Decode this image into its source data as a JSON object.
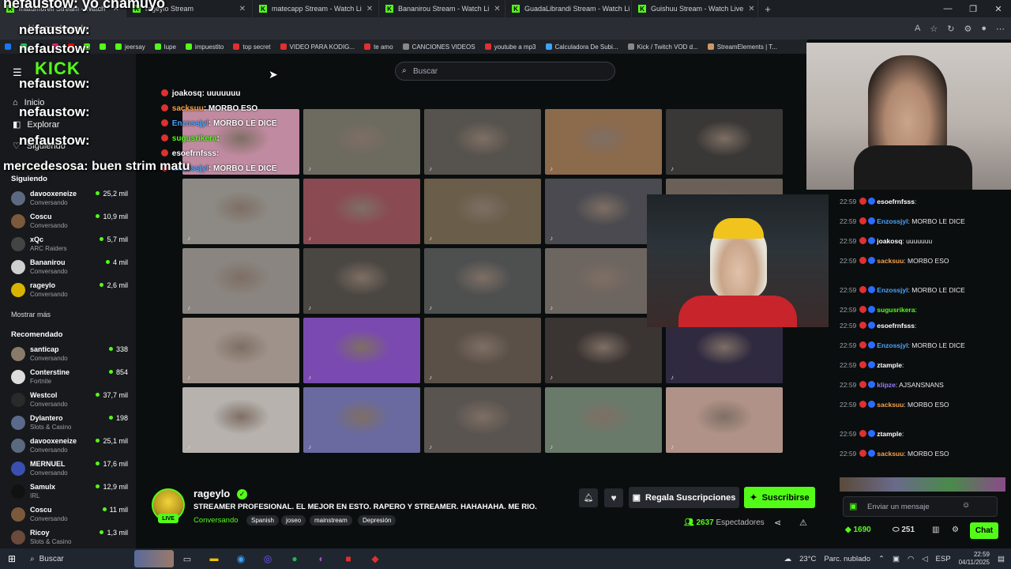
{
  "tabs": [
    {
      "label": "matumorell Stream - Watch"
    },
    {
      "label": "rageylo Stream"
    },
    {
      "label": "matecapp Stream - Watch Li"
    },
    {
      "label": "Bananirou Stream - Watch Li"
    },
    {
      "label": "GuadaLibrandi Stream - Watch Li"
    },
    {
      "label": "Guishuu Stream - Watch Live"
    }
  ],
  "address": {
    "url": "kick.com/rageylo"
  },
  "bookmarks": [
    {
      "label": "jeersay",
      "color": "#53fc18"
    },
    {
      "label": "lupe",
      "color": "#53fc18"
    },
    {
      "label": "impuestito",
      "color": "#53fc18"
    },
    {
      "label": "top secret",
      "color": "#e03030"
    },
    {
      "label": "VIDEO PARA KODIG...",
      "color": "#e03030"
    },
    {
      "label": "te amo",
      "color": "#e03030"
    },
    {
      "label": "CANCIONES VIDEOS",
      "color": "#888888"
    },
    {
      "label": "youtube a mp3",
      "color": "#e03030"
    },
    {
      "label": "Calculadora De Subi...",
      "color": "#3aa3ff"
    },
    {
      "label": "Kick / Twitch VOD d...",
      "color": "#888888"
    },
    {
      "label": "StreamElements | T...",
      "color": "#cc9966"
    }
  ],
  "overlay": {
    "top_name": "nefaustow: yo chamuyo",
    "name1": "nefaustow:",
    "name2": "nefaustow:",
    "name3": "nefaustow:",
    "name4": "nefaustow:",
    "name5": "nefaustow:",
    "mercedesosa": "mercedesosa: buen strim matu"
  },
  "sidebar": {
    "nav": [
      {
        "label": "Inicio"
      },
      {
        "label": "Explorar"
      },
      {
        "label": "Siguiendo"
      }
    ],
    "following_title": "Siguiendo",
    "following": [
      {
        "name": "davooxeneize",
        "sub": "Conversando",
        "viewers": "25,2 mil",
        "color": "#5b6a80"
      },
      {
        "name": "Coscu",
        "sub": "Conversando",
        "viewers": "10,9 mil",
        "color": "#7a5a3a"
      },
      {
        "name": "xQc",
        "sub": "ARC Raiders",
        "viewers": "5,7 mil",
        "color": "#444444"
      },
      {
        "name": "Bananirou",
        "sub": "Conversando",
        "viewers": "4 mil",
        "color": "#cfcfcf"
      },
      {
        "name": "rageylo",
        "sub": "Conversando",
        "viewers": "2,6 mil",
        "color": "#d8b400"
      }
    ],
    "show_more": "Mostrar más",
    "recommended_title": "Recomendado",
    "recommended": [
      {
        "name": "santicap",
        "sub": "Conversando",
        "viewers": "338",
        "color": "#8a7a6a"
      },
      {
        "name": "Conterstine",
        "sub": "Fortnite",
        "viewers": "854",
        "color": "#dddddd"
      },
      {
        "name": "Westcol",
        "sub": "Conversando",
        "viewers": "37,7 mil",
        "color": "#2a2a2a"
      },
      {
        "name": "Dylantero",
        "sub": "Slots & Casino",
        "viewers": "198",
        "color": "#5a6a8a"
      },
      {
        "name": "davooxeneize",
        "sub": "Conversando",
        "viewers": "25,1 mil",
        "color": "#5b6a80"
      },
      {
        "name": "MERNUEL",
        "sub": "Conversando",
        "viewers": "17,6 mil",
        "color": "#3b4fb0"
      },
      {
        "name": "Samulx",
        "sub": "IRL",
        "viewers": "12,9 mil",
        "color": "#111111"
      },
      {
        "name": "Coscu",
        "sub": "Conversando",
        "viewers": "11 mil",
        "color": "#7a5a3a"
      },
      {
        "name": "Ricoy",
        "sub": "Slots & Casino",
        "viewers": "1,3 mil",
        "color": "#6a4a3a"
      }
    ]
  },
  "search": {
    "placeholder": "Buscar"
  },
  "overlay_chat": [
    {
      "user": "joakosq",
      "text": "uuuuuuu",
      "color": "#ffffff"
    },
    {
      "user": "sacksuu",
      "text": "MORBO ESO",
      "color": "#f7a04a"
    },
    {
      "user": "Enzossjyl",
      "text": "MORBO LE DICE",
      "color": "#4aa3ff"
    },
    {
      "user": "sugusrikera",
      "text": "",
      "color": "#53fc18"
    },
    {
      "user": "esoefrnfsss",
      "text": "",
      "color": "#ffffff"
    },
    {
      "user": "Enzossjyl",
      "text": "MORBO LE DICE",
      "color": "#4aa3ff"
    }
  ],
  "video_grid": {
    "colors": [
      "#c08aa0",
      "#6d6a60",
      "#56524d",
      "#8c6a4c",
      "#3a3836",
      "#8d8a85",
      "#8a4a52",
      "#6a5d4a",
      "#4a4a50",
      "#6a6058",
      "#8a8580",
      "#4a4642",
      "#4e5050",
      "#6d6560",
      "#3a3a3a",
      "#9e928a",
      "#7a4ab0",
      "#5a5048",
      "#3a3432",
      "#302a40",
      "#b7b2ae",
      "#6a6aa0",
      "#5a5450",
      "#6a7a6a",
      "#b09288"
    ]
  },
  "chat": {
    "messages": [
      {
        "time": "22:59",
        "user": "esoefrnfsss",
        "text": "",
        "color": "#ffffff"
      },
      {
        "time": "22:59",
        "user": "Enzossjyl",
        "text": "MORBO LE DICE",
        "color": "#4aa3ff"
      },
      {
        "time": "22:59",
        "user": "joakosq",
        "text": "uuuuuuu",
        "color": "#ffffff"
      },
      {
        "time": "22:59",
        "user": "sacksuu",
        "text": "MORBO ESO",
        "color": "#f7a04a"
      },
      {
        "time": "22:59",
        "user": "Enzossjyl",
        "text": "MORBO LE DICE",
        "color": "#4aa3ff"
      },
      {
        "time": "22:59",
        "user": "sugusrikera",
        "text": "",
        "color": "#53fc18"
      },
      {
        "time": "22:59",
        "user": "esoefrnfsss",
        "text": "",
        "color": "#ffffff"
      },
      {
        "time": "22:59",
        "user": "Enzossjyl",
        "text": "MORBO LE DICE",
        "color": "#4aa3ff"
      },
      {
        "time": "22:59",
        "user": "ztample",
        "text": "",
        "color": "#ffffff"
      },
      {
        "time": "22:59",
        "user": "klipze",
        "text": "AJSANSNANS",
        "color": "#9a7aff"
      },
      {
        "time": "22:59",
        "user": "sacksuu",
        "text": "MORBO ESO",
        "color": "#f7a04a"
      },
      {
        "time": "22:59",
        "user": "ztample",
        "text": "",
        "color": "#ffffff"
      },
      {
        "time": "22:59",
        "user": "sacksuu",
        "text": "MORBO ESO",
        "color": "#f7a04a"
      }
    ],
    "input_placeholder": "Enviar un mensaje",
    "points": "1690",
    "count": "251",
    "send_label": "Chat"
  },
  "channel": {
    "name": "rageylo",
    "title": "STREAMER PROFESIONAL. EL MEJOR EN ESTO. RAPERO Y STREAMER. HAHAHAHA. ME RIO.",
    "category": "Conversando",
    "tags": [
      "Spanish",
      "joseo",
      "mainstream",
      "Depresión"
    ],
    "viewers": "2637",
    "viewers_label": "Espectadores",
    "gift_label": "Regala Suscripciones",
    "subscribe_label": "Suscribirse",
    "live_label": "LIVE"
  },
  "taskbar": {
    "search": "Buscar",
    "weather_temp": "23°C",
    "weather_desc": "Parc. nublado",
    "lang": "ESP",
    "time": "22:59",
    "date": "04/11/2025"
  },
  "colors": {
    "accent": "#53fc18",
    "background": "#0b0e0f",
    "sidebar": "#17191c"
  }
}
